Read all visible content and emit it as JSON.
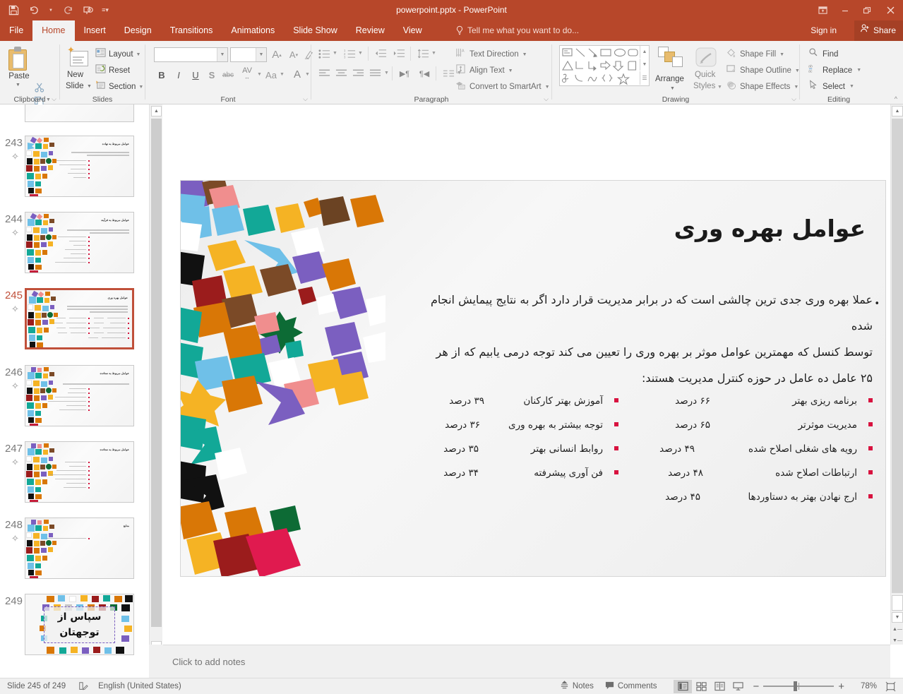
{
  "titlebar": {
    "document_title": "powerpoint.pptx - PowerPoint",
    "qat": [
      {
        "name": "save",
        "glyph": "ὋE"
      },
      {
        "name": "undo",
        "glyph": "↶"
      },
      {
        "name": "redo",
        "glyph": "↻"
      },
      {
        "name": "start-from-beginning",
        "glyph": "▷"
      },
      {
        "name": "customize-qat",
        "glyph": "☰"
      }
    ],
    "window_controls": {
      "ribbon_display_options": "▣",
      "minimize": "—",
      "restore": "❐",
      "close": "✕"
    },
    "sign_in": "Sign in",
    "share": "Share"
  },
  "ribbon_tabs": [
    {
      "label": "File",
      "active": false
    },
    {
      "label": "Home",
      "active": true
    },
    {
      "label": "Insert",
      "active": false
    },
    {
      "label": "Design",
      "active": false
    },
    {
      "label": "Transitions",
      "active": false
    },
    {
      "label": "Animations",
      "active": false
    },
    {
      "label": "Slide Show",
      "active": false
    },
    {
      "label": "Review",
      "active": false
    },
    {
      "label": "View",
      "active": false
    }
  ],
  "tell_me": "Tell me what you want to do...",
  "ribbon": {
    "clipboard": {
      "group_label": "Clipboard",
      "paste_label": "Paste",
      "cut_icon": "✂",
      "copy_icon": "⧉",
      "format_painter_icon": "🖌"
    },
    "slides": {
      "group_label": "Slides",
      "new_slide_label_line1": "New",
      "new_slide_label_line2": "Slide",
      "layout": "Layout",
      "reset": "Reset",
      "section": "Section"
    },
    "font": {
      "group_label": "Font",
      "font_name_value": "",
      "font_size_value": "",
      "increase_font": "A",
      "decrease_font": "A",
      "clear_formatting": "✐",
      "bold": "B",
      "italic": "I",
      "underline": "U",
      "shadow": "S",
      "strikethrough": "abc",
      "character_spacing": "AV",
      "change_case": "Aa",
      "font_color": "A"
    },
    "paragraph": {
      "group_label": "Paragraph",
      "text_direction": "Text Direction",
      "align_text": "Align Text",
      "convert_to_smartart": "Convert to SmartArt"
    },
    "drawing": {
      "group_label": "Drawing",
      "arrange": "Arrange",
      "quick_styles_line1": "Quick",
      "quick_styles_line2": "Styles",
      "shape_fill": "Shape Fill",
      "shape_outline": "Shape Outline",
      "shape_effects": "Shape Effects"
    },
    "editing": {
      "group_label": "Editing",
      "find": "Find",
      "replace": "Replace",
      "select": "Select"
    }
  },
  "thumbnails": [
    {
      "number": "242",
      "selected": false,
      "partial": true,
      "kind": "content",
      "title": "",
      "lines": 0,
      "bullets": 0
    },
    {
      "number": "243",
      "selected": false,
      "partial": false,
      "kind": "content",
      "title": "عوامل مربوط به نهاده",
      "lines": 2,
      "bullets": 5
    },
    {
      "number": "244",
      "selected": false,
      "partial": false,
      "kind": "content",
      "title": "عوامل مربوط به فرآیند",
      "lines": 2,
      "bullets": 7
    },
    {
      "number": "245",
      "selected": true,
      "partial": false,
      "kind": "twocol",
      "title": "عوامل بهره وری",
      "lines": 3,
      "bullets": 5
    },
    {
      "number": "246",
      "selected": false,
      "partial": false,
      "kind": "content",
      "title": "عوامل مربوط به ستانده",
      "lines": 1,
      "bullets": 6
    },
    {
      "number": "247",
      "selected": false,
      "partial": false,
      "kind": "content",
      "title": "عوامل مربوط به ستانده",
      "lines": 0,
      "bullets": 7
    },
    {
      "number": "248",
      "selected": false,
      "partial": false,
      "kind": "content",
      "title": "منابع",
      "lines": 0,
      "bullets": 1
    },
    {
      "number": "249",
      "selected": false,
      "partial": false,
      "kind": "thanks",
      "title": "سپاس از توجهتان",
      "lines": 0,
      "bullets": 0
    }
  ],
  "slide": {
    "title": "عوامل بهره وری",
    "body_lines": [
      "عملا بهره وری جدی ترین چالشی است که در برابر مدیریت قرار دارد اگر به نتایج پیمایش انجام شده",
      "توسط کنسل که مهمترین عوامل موثر بر بهره وری را تعیین می کند توجه درمی یابیم که از هر",
      "۲۵ عامل ده عامل در حوزه کنترل مدیریت هستند:"
    ],
    "bullet_char": "•",
    "bullet_square_color": "#d8123f",
    "column_right": [
      {
        "name": "برنامه ریزی بهتر",
        "percent": "۶۶ درصد"
      },
      {
        "name": "مدیریت موثرتر",
        "percent": "۶۵ درصد"
      },
      {
        "name": "رویه های شغلی اصلاح شده",
        "percent": "۴۹ درصد"
      },
      {
        "name": "ارتباطات اصلاح شده",
        "percent": "۴۸ درصد"
      },
      {
        "name": "ارج نهادن بهتر به دستاوردها",
        "percent": "۴۵ درصد"
      }
    ],
    "column_left": [
      {
        "name": "آموزش بهتر کارکنان",
        "percent": "۳۹ درصد"
      },
      {
        "name": "توجه بیشتر به بهره وری",
        "percent": "۳۶ درصد"
      },
      {
        "name": "روابط انسانی بهتر",
        "percent": "۳۵ درصد"
      },
      {
        "name": "فن آوری پیشرفته",
        "percent": "۳۴ درصد"
      }
    ]
  },
  "notes": {
    "placeholder": "Click to add notes"
  },
  "statusbar": {
    "slide_indicator": "Slide 245 of 249",
    "language": "English (United States)",
    "notes_button": "Notes",
    "comments_button": "Comments",
    "zoom_level": "78%",
    "zoom_minus": "−",
    "zoom_plus": "+",
    "views": [
      {
        "name": "normal-view",
        "glyph": "▤",
        "active": true
      },
      {
        "name": "slide-sorter-view",
        "glyph": "☷",
        "active": false
      },
      {
        "name": "reading-view",
        "glyph": "▥",
        "active": false
      },
      {
        "name": "slide-show-view",
        "glyph": "□",
        "active": false
      }
    ],
    "fit_to_window": "⛶"
  },
  "colors": {
    "accent": "#b7472a",
    "bullet_square": "#d8123f",
    "selected_thumb_border": "#c0503a"
  }
}
